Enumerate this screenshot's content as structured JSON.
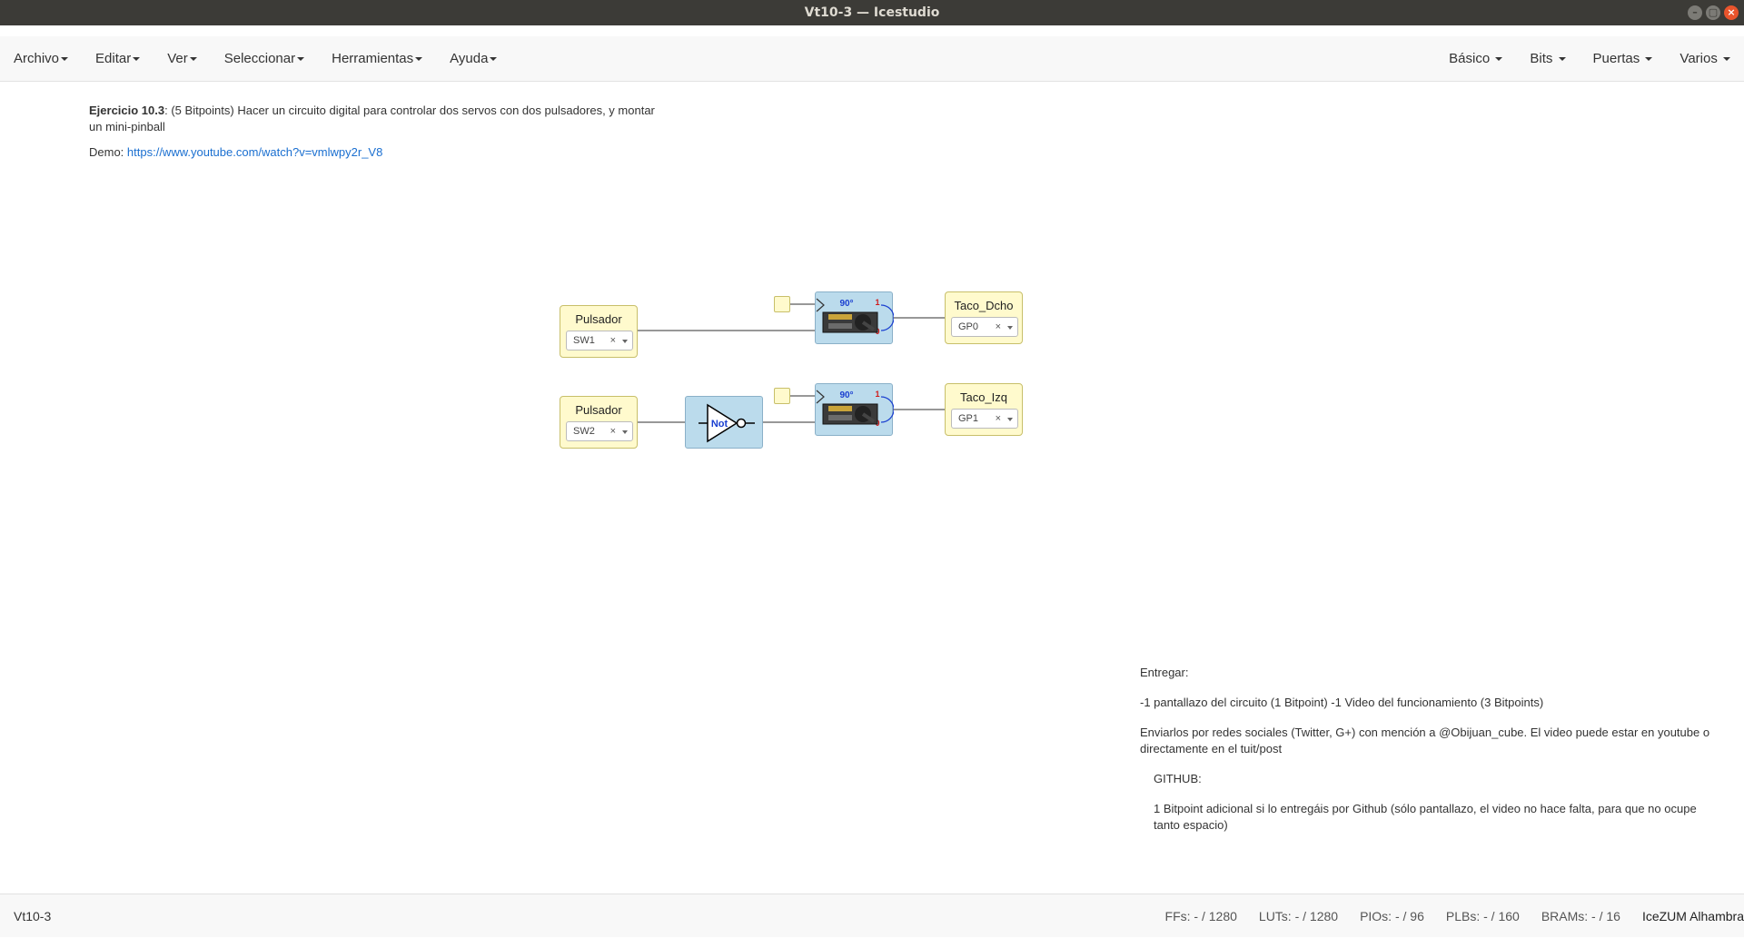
{
  "window": {
    "title": "Vt10-3 — Icestudio"
  },
  "menu": {
    "left": [
      "Archivo",
      "Editar",
      "Ver",
      "Seleccionar",
      "Herramientas",
      "Ayuda"
    ],
    "right": [
      "Básico",
      "Bits",
      "Puertas",
      "Varios"
    ]
  },
  "notes": {
    "exercise_title": "Ejercicio 10.3",
    "exercise_text": ": (5 Bitpoints) Hacer un circuito digital para controlar dos servos con dos pulsadores, y montar un mini-pinball",
    "demo_label": "Demo: ",
    "demo_link": "https://www.youtube.com/watch?v=vmlwpy2r_V8",
    "deliver_title": "Entregar:",
    "deliver_line1": "-1 pantallazo del circuito (1 Bitpoint) -1 Video del funcionamiento (3 Bitpoints)",
    "deliver_line2": "Enviarlos por redes sociales (Twitter, G+) con mención a @Obijuan_cube. El video puede estar en youtube o directamente en el tuit/post",
    "github_title": "GITHUB:",
    "github_text": "1 Bitpoint adicional si lo entregáis por Github (sólo pantallazo, el video no hace falta, para que no ocupe tanto espacio)"
  },
  "blocks": {
    "input1": {
      "name": "Pulsador",
      "pin": "SW1"
    },
    "input2": {
      "name": "Pulsador",
      "pin": "SW2"
    },
    "output1": {
      "name": "Taco_Dcho",
      "pin": "GP0"
    },
    "output2": {
      "name": "Taco_Izq",
      "pin": "GP1"
    },
    "not_gate": {
      "label": "Not"
    },
    "servo1": {
      "angle": "90°",
      "high": "1",
      "low": "0"
    },
    "servo2": {
      "angle": "90°",
      "high": "1",
      "low": "0"
    },
    "pin_clear": "×"
  },
  "status": {
    "project": "Vt10-3",
    "ffs": "FFs:  - / 1280",
    "luts": "LUTs:  - / 1280",
    "pios": "PIOs:  - / 96",
    "plbs": "PLBs:  - / 160",
    "brams": "BRAMs:  - / 16",
    "board": "IceZUM Alhambra"
  },
  "colors": {
    "io_block": "#fffacd",
    "logic_block": "#bbdbec",
    "link": "#1a6fd0",
    "titlebar": "#3c3b37"
  }
}
